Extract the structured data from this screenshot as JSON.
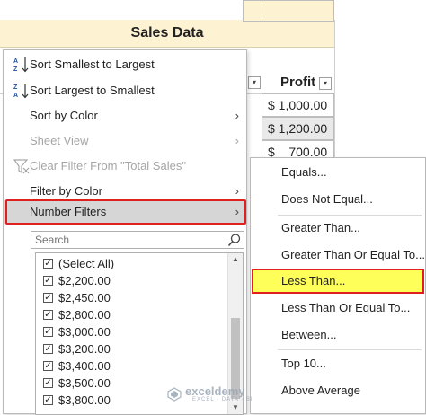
{
  "sheet": {
    "title": "Sales Data",
    "profit_header": "Profit",
    "profit_values": [
      "$ 1,000.00",
      "$ 1,200.00",
      "$    700.00"
    ]
  },
  "menu": {
    "items": [
      {
        "key": "sort-asc",
        "label": "Sort Smallest to Largest",
        "underline": "S",
        "rest": "ort Smallest to Largest",
        "icon": "sort-ascending-icon"
      },
      {
        "key": "sort-desc",
        "label": "Sort Largest to Smallest",
        "underline": "o",
        "pre": "S",
        "rest": "rt Largest to Smallest",
        "icon": "sort-descending-icon"
      },
      {
        "key": "sort-color",
        "label": "Sort by Color"
      },
      {
        "key": "sheet-view",
        "label": "Sheet View"
      },
      {
        "key": "clear-filter",
        "label": "Clear Filter From \"Total Sales\""
      },
      {
        "key": "filter-color",
        "label": "Filter by Color"
      },
      {
        "key": "number-filters",
        "label": "Number Filters"
      }
    ],
    "search_placeholder": "Search",
    "list": [
      "(Select All)",
      "$2,200.00",
      "$2,450.00",
      "$2,800.00",
      "$3,000.00",
      "$3,200.00",
      "$3,400.00",
      "$3,500.00",
      "$3,800.00"
    ]
  },
  "submenu": {
    "items": [
      "Equals...",
      "Does Not Equal...",
      "Greater Than...",
      "Greater Than Or Equal To...",
      "Less Than...",
      "Less Than Or Equal To...",
      "Between...",
      "Top 10...",
      "Above Average"
    ]
  },
  "watermark": {
    "name": "exceldemy",
    "tag": "EXCEL · DATA · BI"
  },
  "colors": {
    "highlight": "#ffff5a",
    "outline": "#e01f1f",
    "header_fill": "#fdf3d2"
  }
}
